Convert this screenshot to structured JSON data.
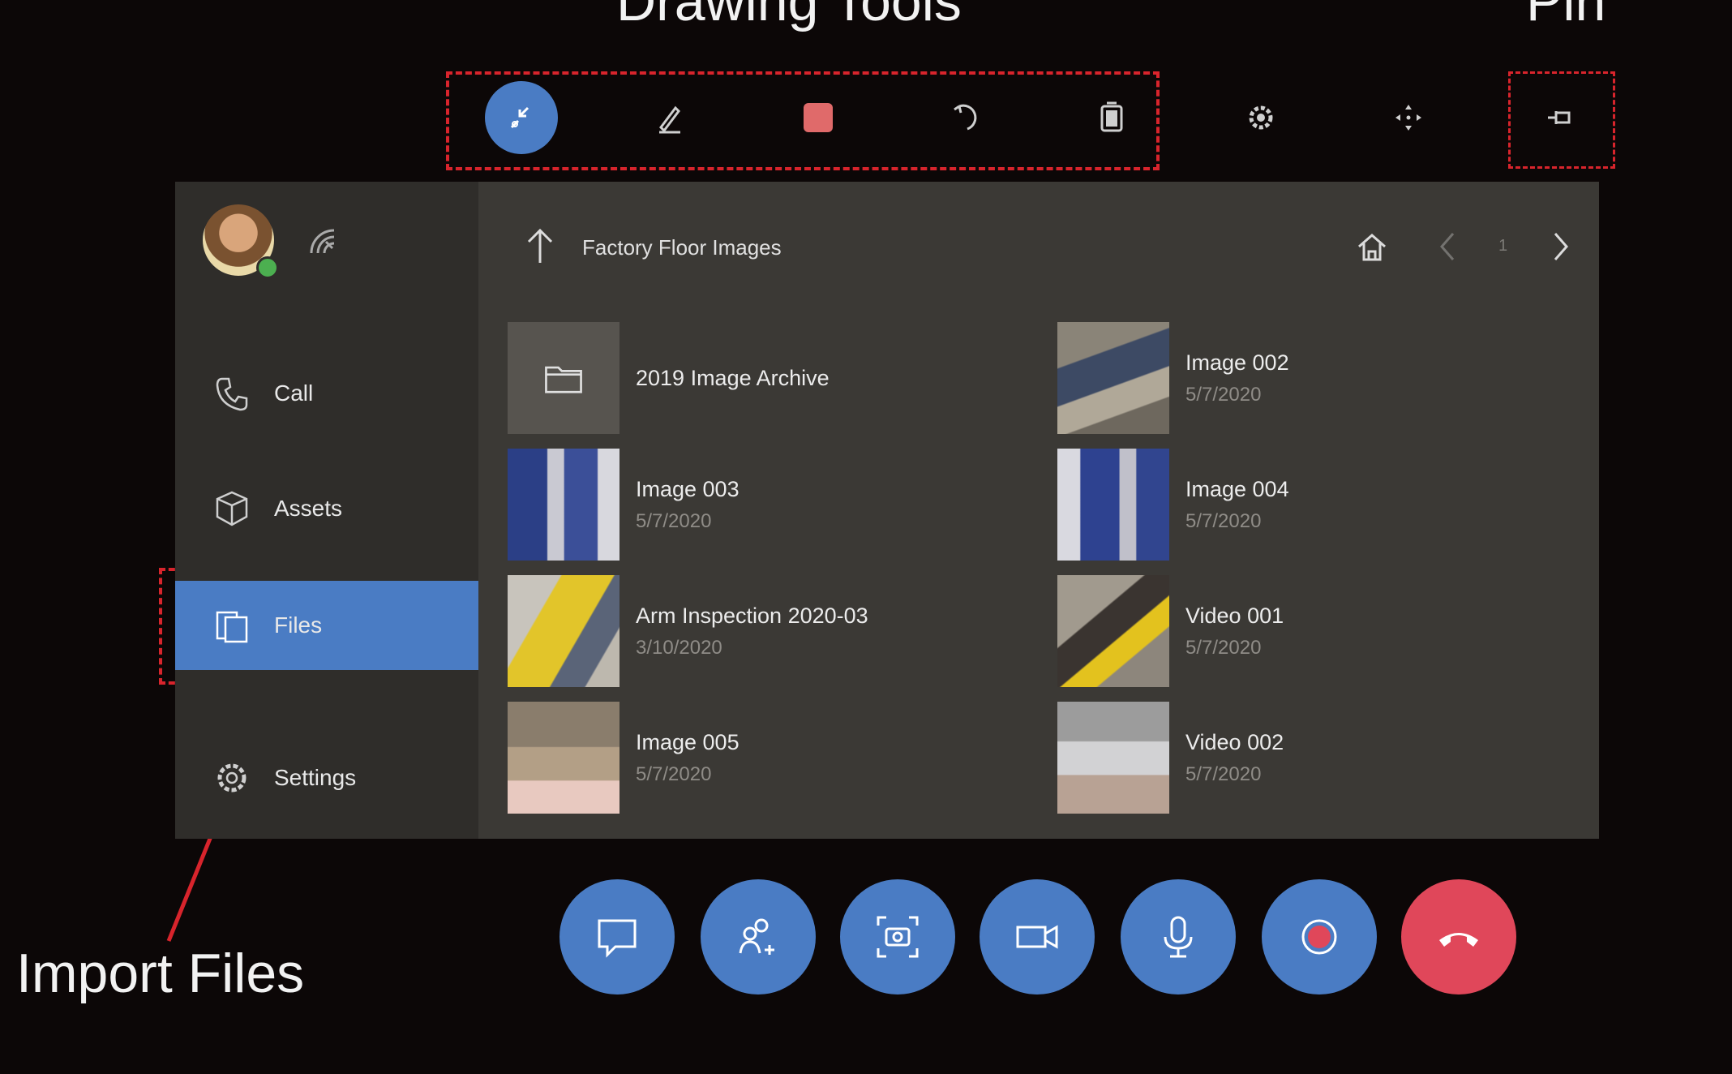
{
  "annotations": {
    "drawing_tools": "Drawing Tools",
    "pin": "Pin",
    "import_files": "Import Files"
  },
  "toolbar": {
    "tools": [
      {
        "icon": "collapse-arrows-icon",
        "active": true
      },
      {
        "icon": "pen-icon"
      },
      {
        "icon": "color-swatch-icon",
        "color": "#e06a6a"
      },
      {
        "icon": "undo-icon"
      },
      {
        "icon": "trash-icon"
      },
      {
        "icon": "gear-icon"
      },
      {
        "icon": "move-arrows-icon"
      },
      {
        "icon": "pin-icon"
      }
    ]
  },
  "sidebar": {
    "items": [
      {
        "label": "Call",
        "icon": "phone-icon"
      },
      {
        "label": "Assets",
        "icon": "box-icon"
      },
      {
        "label": "Files",
        "icon": "files-icon",
        "selected": true
      },
      {
        "label": "Settings",
        "icon": "gear-icon"
      }
    ]
  },
  "content": {
    "folder_title": "Factory Floor Images",
    "page": "1",
    "files": [
      {
        "name": "2019 Image Archive",
        "date": "",
        "type": "folder"
      },
      {
        "name": "Image 002",
        "date": "5/7/2020"
      },
      {
        "name": "Image 003",
        "date": "5/7/2020"
      },
      {
        "name": "Image 004",
        "date": "5/7/2020"
      },
      {
        "name": "Arm Inspection 2020-03",
        "date": "3/10/2020"
      },
      {
        "name": "Video 001",
        "date": "5/7/2020"
      },
      {
        "name": "Image 005",
        "date": "5/7/2020"
      },
      {
        "name": "Video 002",
        "date": "5/7/2020"
      }
    ]
  },
  "call_controls": [
    {
      "icon": "chat-icon"
    },
    {
      "icon": "add-participant-icon"
    },
    {
      "icon": "snapshot-icon"
    },
    {
      "icon": "video-camera-icon"
    },
    {
      "icon": "microphone-icon"
    },
    {
      "icon": "record-icon",
      "color": "#e0475a"
    },
    {
      "icon": "end-call-icon",
      "color": "#e0475a"
    }
  ],
  "colors": {
    "accent": "#4a7cc4",
    "annotation_red": "#d8242c",
    "end_call": "#e0475a",
    "panel_bg": "#3b3935",
    "sidebar_bg": "#2f2d2a"
  }
}
